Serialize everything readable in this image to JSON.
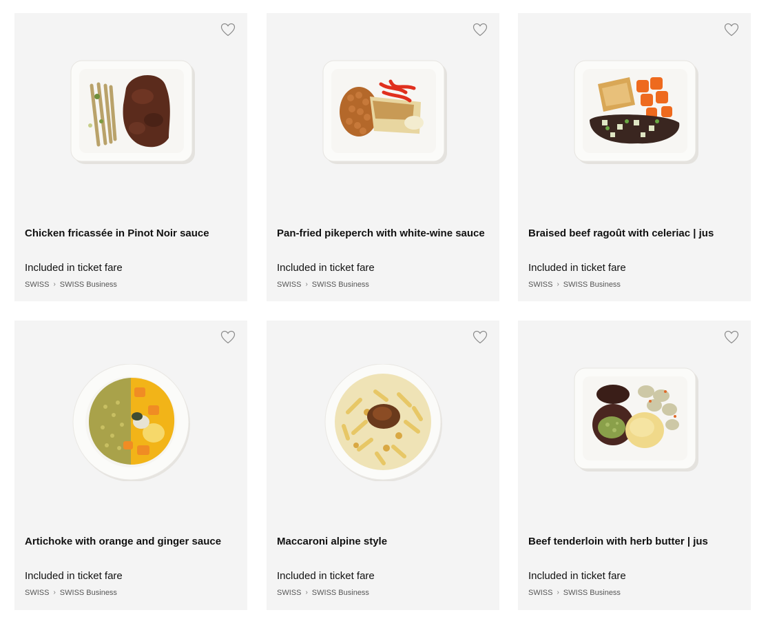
{
  "products": [
    {
      "title": "Chicken fricassée in Pinot Noir sauce",
      "price": "Included in ticket fare",
      "breadcrumb": [
        "SWISS",
        "SWISS Business"
      ],
      "image": "tray-chicken-fricassee",
      "favorite_icon": "heart-outline-icon"
    },
    {
      "title": "Pan-fried pikeperch with white-wine sauce",
      "price": "Included in ticket fare",
      "breadcrumb": [
        "SWISS",
        "SWISS Business"
      ],
      "image": "tray-pikeperch",
      "favorite_icon": "heart-outline-icon"
    },
    {
      "title": "Braised beef ragoût with celeriac | jus",
      "price": "Included in ticket fare",
      "breadcrumb": [
        "SWISS",
        "SWISS Business"
      ],
      "image": "tray-beef-ragout",
      "favorite_icon": "heart-outline-icon"
    },
    {
      "title": "Artichoke with orange and ginger sauce",
      "price": "Included in ticket fare",
      "breadcrumb": [
        "SWISS",
        "SWISS Business"
      ],
      "image": "bowl-artichoke",
      "favorite_icon": "heart-outline-icon"
    },
    {
      "title": "Maccaroni alpine style",
      "price": "Included in ticket fare",
      "breadcrumb": [
        "SWISS",
        "SWISS Business"
      ],
      "image": "bowl-maccaroni",
      "favorite_icon": "heart-outline-icon"
    },
    {
      "title": "Beef tenderloin with herb butter | jus",
      "price": "Included in ticket fare",
      "breadcrumb": [
        "SWISS",
        "SWISS Business"
      ],
      "image": "tray-beef-tenderloin",
      "favorite_icon": "heart-outline-icon"
    }
  ],
  "colors": {
    "card_bg": "#f4f4f4",
    "text": "#111111",
    "breadcrumb": "#555555",
    "heart": "#8a8a8a"
  }
}
